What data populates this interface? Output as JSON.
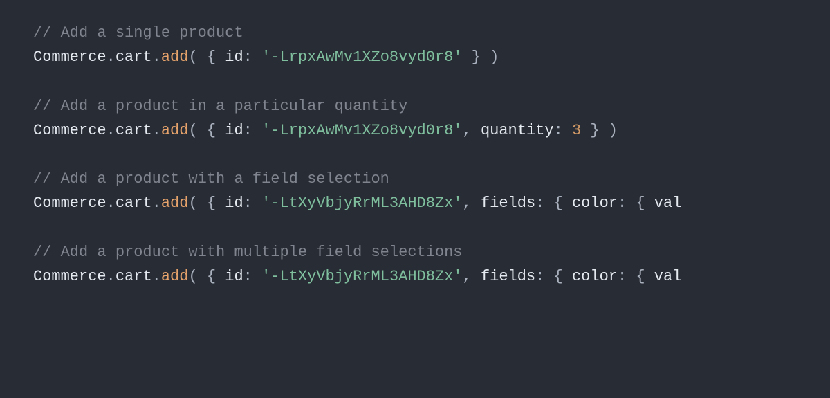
{
  "lines": [
    {
      "type": "comment",
      "text": "// Add a single product"
    },
    {
      "type": "code",
      "tokens": [
        {
          "t": "ident",
          "v": "Commerce"
        },
        {
          "t": "punct",
          "v": "."
        },
        {
          "t": "ident",
          "v": "cart"
        },
        {
          "t": "punct",
          "v": "."
        },
        {
          "t": "method",
          "v": "add"
        },
        {
          "t": "punct",
          "v": "( { "
        },
        {
          "t": "ident",
          "v": "id"
        },
        {
          "t": "punct",
          "v": ": "
        },
        {
          "t": "string",
          "v": "'-LrpxAwMv1XZo8vyd0r8'"
        },
        {
          "t": "punct",
          "v": " } )"
        }
      ]
    },
    {
      "type": "blank"
    },
    {
      "type": "comment",
      "text": "// Add a product in a particular quantity"
    },
    {
      "type": "code",
      "tokens": [
        {
          "t": "ident",
          "v": "Commerce"
        },
        {
          "t": "punct",
          "v": "."
        },
        {
          "t": "ident",
          "v": "cart"
        },
        {
          "t": "punct",
          "v": "."
        },
        {
          "t": "method",
          "v": "add"
        },
        {
          "t": "punct",
          "v": "( { "
        },
        {
          "t": "ident",
          "v": "id"
        },
        {
          "t": "punct",
          "v": ": "
        },
        {
          "t": "string",
          "v": "'-LrpxAwMv1XZo8vyd0r8'"
        },
        {
          "t": "punct",
          "v": ", "
        },
        {
          "t": "ident",
          "v": "quantity"
        },
        {
          "t": "punct",
          "v": ": "
        },
        {
          "t": "number",
          "v": "3"
        },
        {
          "t": "punct",
          "v": " } )"
        }
      ]
    },
    {
      "type": "blank"
    },
    {
      "type": "comment",
      "text": "// Add a product with a field selection"
    },
    {
      "type": "code",
      "tokens": [
        {
          "t": "ident",
          "v": "Commerce"
        },
        {
          "t": "punct",
          "v": "."
        },
        {
          "t": "ident",
          "v": "cart"
        },
        {
          "t": "punct",
          "v": "."
        },
        {
          "t": "method",
          "v": "add"
        },
        {
          "t": "punct",
          "v": "( { "
        },
        {
          "t": "ident",
          "v": "id"
        },
        {
          "t": "punct",
          "v": ": "
        },
        {
          "t": "string",
          "v": "'-LtXyVbjyRrML3AHD8Zx'"
        },
        {
          "t": "punct",
          "v": ", "
        },
        {
          "t": "ident",
          "v": "fields"
        },
        {
          "t": "punct",
          "v": ": { "
        },
        {
          "t": "ident",
          "v": "color"
        },
        {
          "t": "punct",
          "v": ": { "
        },
        {
          "t": "ident",
          "v": "val"
        }
      ]
    },
    {
      "type": "blank"
    },
    {
      "type": "comment",
      "text": "// Add a product with multiple field selections"
    },
    {
      "type": "code",
      "tokens": [
        {
          "t": "ident",
          "v": "Commerce"
        },
        {
          "t": "punct",
          "v": "."
        },
        {
          "t": "ident",
          "v": "cart"
        },
        {
          "t": "punct",
          "v": "."
        },
        {
          "t": "method",
          "v": "add"
        },
        {
          "t": "punct",
          "v": "( { "
        },
        {
          "t": "ident",
          "v": "id"
        },
        {
          "t": "punct",
          "v": ": "
        },
        {
          "t": "string",
          "v": "'-LtXyVbjyRrML3AHD8Zx'"
        },
        {
          "t": "punct",
          "v": ", "
        },
        {
          "t": "ident",
          "v": "fields"
        },
        {
          "t": "punct",
          "v": ": { "
        },
        {
          "t": "ident",
          "v": "color"
        },
        {
          "t": "punct",
          "v": ": { "
        },
        {
          "t": "ident",
          "v": "val"
        }
      ]
    }
  ]
}
